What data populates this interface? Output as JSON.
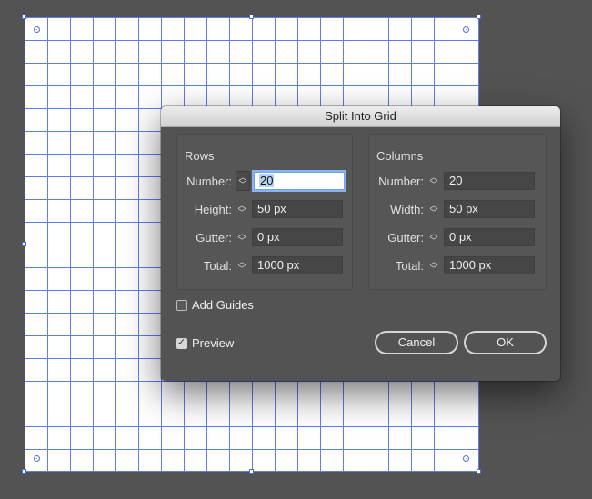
{
  "dialog": {
    "title": "Split Into Grid",
    "rows": {
      "title": "Rows",
      "fields": [
        {
          "label": "Number:",
          "value": "20"
        },
        {
          "label": "Height:",
          "value": "50 px"
        },
        {
          "label": "Gutter:",
          "value": "0 px"
        },
        {
          "label": "Total:",
          "value": "1000 px"
        }
      ]
    },
    "columns": {
      "title": "Columns",
      "fields": [
        {
          "label": "Number:",
          "value": "20"
        },
        {
          "label": "Width:",
          "value": "50 px"
        },
        {
          "label": "Gutter:",
          "value": "0 px"
        },
        {
          "label": "Total:",
          "value": "1000 px"
        }
      ]
    },
    "add_guides": {
      "label": "Add Guides",
      "checked": false
    },
    "preview": {
      "label": "Preview",
      "checked": true
    },
    "cancel_label": "Cancel",
    "ok_label": "OK"
  },
  "artboard": {
    "grid_rows": 20,
    "grid_columns": 20,
    "grid_color": "#5b7df0"
  },
  "colors": {
    "canvas_bg": "#535353",
    "dialog_bg": "#535353",
    "accent": "#6fa2ee"
  }
}
